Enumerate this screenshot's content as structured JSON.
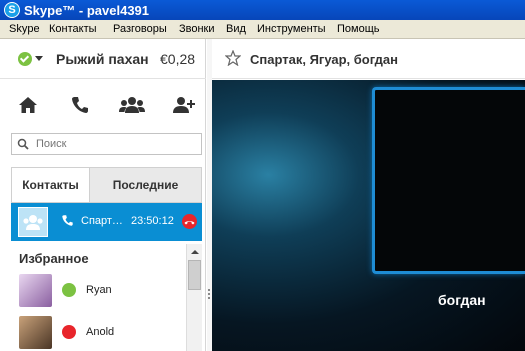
{
  "window": {
    "title": "Skype™ - pavel4391",
    "app_icon_letter": "S"
  },
  "menu": [
    "Skype",
    "Контакты",
    "Разговоры",
    "Звонки",
    "Вид",
    "Инструменты",
    "Помощь"
  ],
  "profile": {
    "name": "Рыжий пахан",
    "credit": "€0,28",
    "status_color": "#7cc242"
  },
  "actions": [
    "home-icon",
    "phone-icon",
    "group-icon",
    "add-contact-icon"
  ],
  "search": {
    "placeholder": "Поиск"
  },
  "tabs": {
    "contacts": "Контакты",
    "recent": "Последние"
  },
  "active_conversation": {
    "name": "Спарт…",
    "time": "23:50:12",
    "highlight_color": "#0a8ed3"
  },
  "favorites": {
    "header": "Избранное",
    "contacts": [
      {
        "name": "Ryan",
        "status_color": "#7cc242"
      },
      {
        "name": "Anold",
        "status_color": "#e8252b"
      }
    ]
  },
  "chat": {
    "title": "Спартак, Ягуар, богдан",
    "video_label": "богдан"
  }
}
